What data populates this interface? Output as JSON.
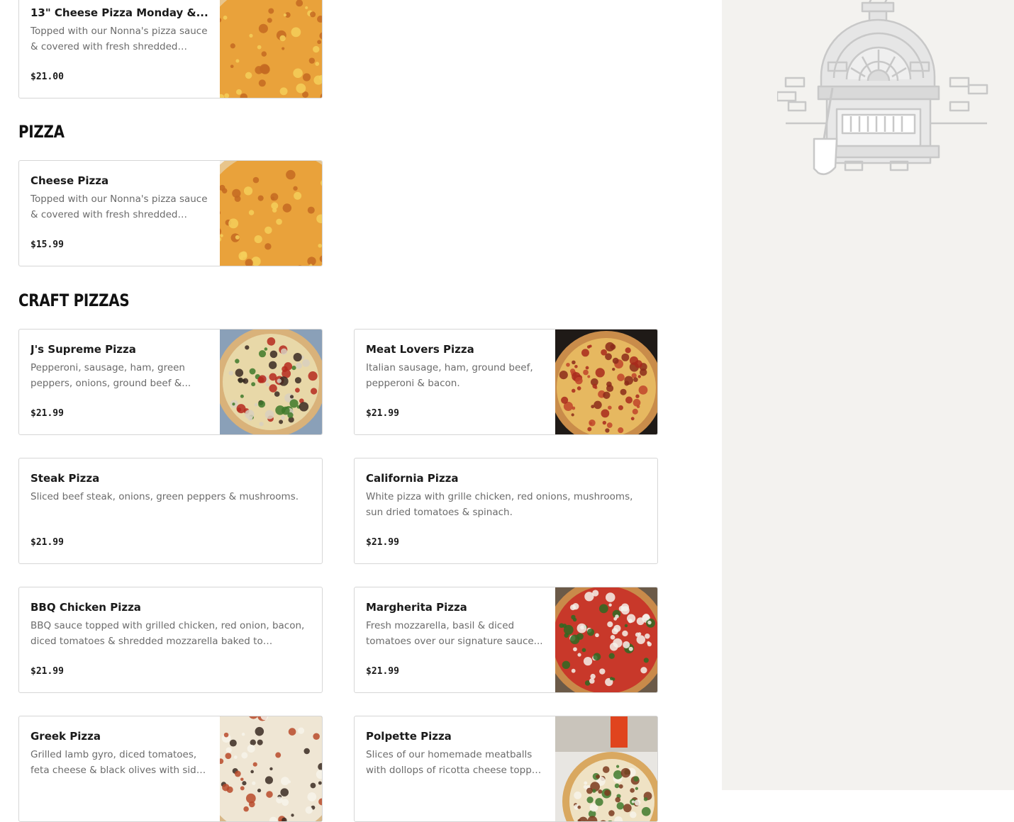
{
  "sections": [
    {
      "title": "",
      "items": [
        {
          "name": "13\" Cheese Pizza Monday &...",
          "description": "Topped with our Nonna's pizza sauce & covered with fresh shredded mozzarel...",
          "price": "$21.00",
          "image": "cheese-pizza-photo"
        }
      ]
    },
    {
      "title": "PIZZA",
      "items": [
        {
          "name": "Cheese Pizza",
          "description": "Topped with our Nonna's pizza sauce & covered with fresh shredded mozzarel...",
          "price": "$15.99",
          "image": "cheese-pizza-photo"
        }
      ]
    },
    {
      "title": "CRAFT PIZZAS",
      "items": [
        {
          "name": "J's Supreme Pizza",
          "description": "Pepperoni, sausage, ham, green peppers, onions, ground beef &...",
          "price": "$21.99",
          "image": "supreme-pizza-photo"
        },
        {
          "name": "Meat Lovers Pizza",
          "description": "Italian sausage, ham, ground beef, pepperoni & bacon.",
          "price": "$21.99",
          "image": "meat-lovers-pizza-photo"
        },
        {
          "name": "Steak Pizza",
          "description": "Sliced beef steak, onions, green peppers & mushrooms.",
          "price": "$21.99",
          "image": ""
        },
        {
          "name": "California Pizza",
          "description": "White pizza with grille chicken, red onions, mushrooms, sun dried tomatoes & spinach.",
          "price": "$21.99",
          "image": ""
        },
        {
          "name": "BBQ Chicken Pizza",
          "description": "BBQ sauce topped with grilled chicken, red onion, bacon, diced tomatoes & shredded mozzarella baked to perfection...",
          "price": "$21.99",
          "image": ""
        },
        {
          "name": "Margherita Pizza",
          "description": "Fresh mozzarella, basil & diced tomatoes over our signature sauce...",
          "price": "$21.99",
          "image": "margherita-pizza-photo"
        },
        {
          "name": "Greek Pizza",
          "description": "Grilled lamb gyro, diced tomatoes, feta cheese & black olives with side of...",
          "price": "",
          "image": "greek-pizza-photo"
        },
        {
          "name": "Polpette Pizza",
          "description": "Slices of our homemade meatballs with dollops of ricotta cheese topped with...",
          "price": "",
          "image": "polpette-pizza-photo"
        }
      ]
    }
  ],
  "sidebar": {
    "illustration": "pizza-oven-illustration"
  },
  "colors": {
    "page_bg": "#ffffff",
    "sidebar_bg": "#f3f2ef",
    "card_border": "#d6d6d6",
    "desc_text": "#6b6b6b"
  }
}
